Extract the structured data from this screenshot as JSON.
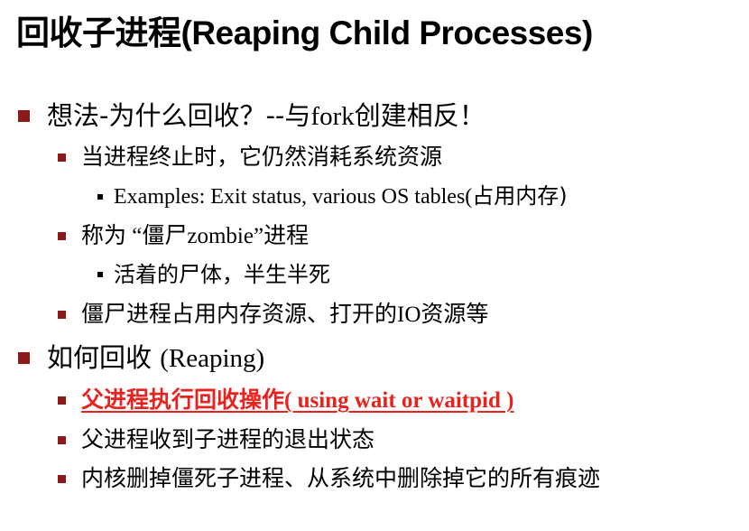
{
  "title": "回收子进程(Reaping Child Processes)",
  "accent_color": "#8b1a1a",
  "highlight_color": "#e8231f",
  "items": [
    {
      "level": 1,
      "parts": [
        {
          "text": "想法-为什么回收？--与"
        },
        {
          "text": "fork",
          "serif": true
        },
        {
          "text": "创建相反！"
        }
      ]
    },
    {
      "level": 2,
      "parts": [
        {
          "text": "当进程终止时，它仍然消耗系统资源"
        }
      ]
    },
    {
      "level": 3,
      "parts": [
        {
          "text": "Examples: Exit status, various OS tables(",
          "serif": true
        },
        {
          "text": "占用内存)"
        }
      ]
    },
    {
      "level": 2,
      "parts": [
        {
          "text": "称为 “",
          "serif": true
        },
        {
          "text": "僵尸"
        },
        {
          "text": "zombie”",
          "serif": true
        },
        {
          "text": "进程"
        }
      ]
    },
    {
      "level": 3,
      "parts": [
        {
          "text": "活着的尸体，半生半死"
        }
      ]
    },
    {
      "level": 2,
      "parts": [
        {
          "text": "僵尸进程占用内存资源、打开的"
        },
        {
          "text": "IO",
          "serif": true
        },
        {
          "text": "资源等"
        }
      ]
    },
    {
      "level": 1,
      "parts": [
        {
          "text": "如何回收 "
        },
        {
          "text": "(Reaping)",
          "serif": true
        }
      ]
    },
    {
      "level": 2,
      "highlight": true,
      "parts": [
        {
          "text": "父进程执行回收操作"
        },
        {
          "text": "( using wait or waitpid )",
          "serif": true
        }
      ]
    },
    {
      "level": 2,
      "parts": [
        {
          "text": "父进程收到子进程的退出状态"
        }
      ]
    },
    {
      "level": 2,
      "parts": [
        {
          "text": "内核删掉僵死子进程、从系统中删除掉它的所有痕迹"
        }
      ]
    }
  ]
}
